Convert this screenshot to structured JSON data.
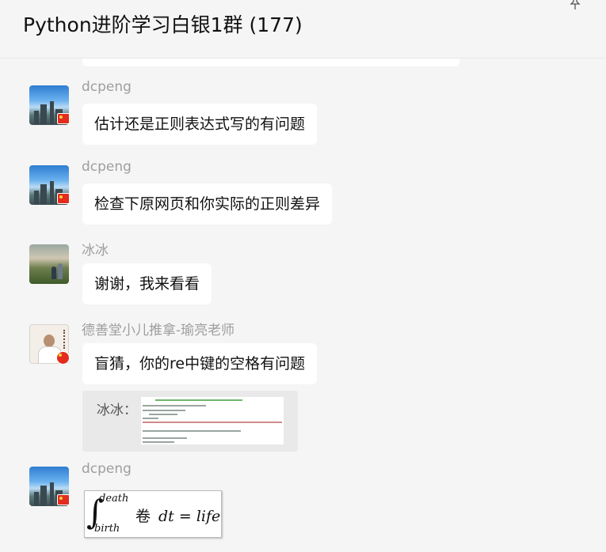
{
  "header": {
    "title": "Python进阶学习白银1群 (177)",
    "pin_icon": "pin-icon"
  },
  "messages": [
    {
      "sender": "dcpeng",
      "text": "估计还是正则表达式写的有问题",
      "avatar": "city-skyline-avatar"
    },
    {
      "sender": "dcpeng",
      "text": "检查下原网页和你实际的正则差异",
      "avatar": "city-skyline-avatar"
    },
    {
      "sender": "冰冰",
      "text": "谢谢，我来看看",
      "avatar": "field-kids-avatar"
    },
    {
      "sender": "德善堂小儿推拿-瑜亮老师",
      "text": "盲猜，你的re中键的空格有问题",
      "avatar": "doctor-avatar"
    }
  ],
  "quote": {
    "label": "冰冰：",
    "image": "code-screenshot-thumbnail"
  },
  "last_message": {
    "sender": "dcpeng",
    "avatar": "city-skyline-avatar",
    "formula": {
      "upper": "death",
      "lower": "birth",
      "juan": "卷",
      "body": "dt = life"
    }
  }
}
